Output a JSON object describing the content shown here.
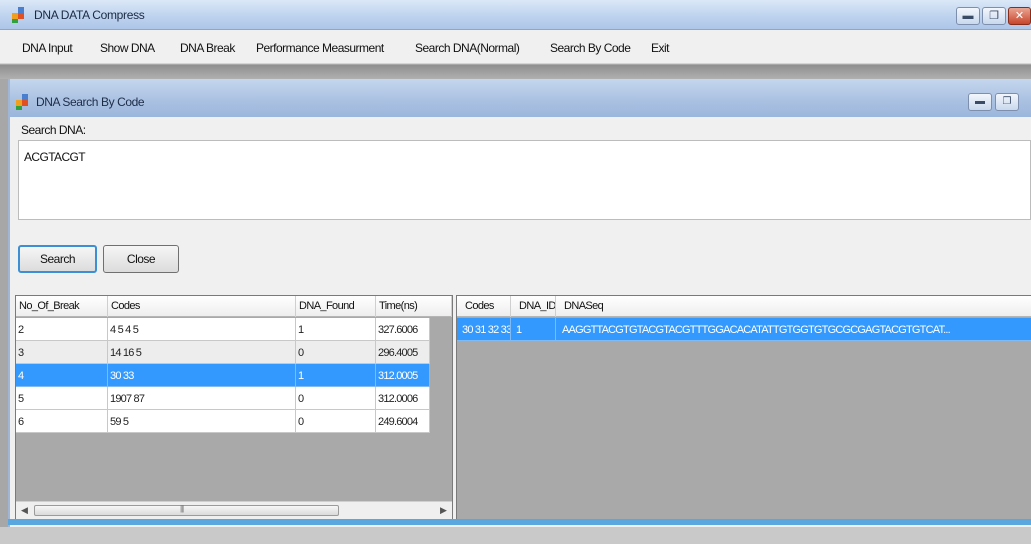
{
  "app": {
    "title": "DNA DATA Compress",
    "window_buttons": {
      "minimize": "▬",
      "restore": "❐",
      "close": "✕"
    }
  },
  "menu": [
    "DNA Input",
    "Show DNA",
    "DNA Break",
    "Performance Measurment",
    "Search DNA(Normal)",
    "Search By Code",
    "Exit"
  ],
  "child": {
    "title": "DNA Search By Code",
    "window_buttons": {
      "minimize": "▬",
      "restore": "❐"
    },
    "search_label": "Search DNA:",
    "search_value": "ACGTACGT",
    "buttons": {
      "search": "Search",
      "close": "Close"
    }
  },
  "left_grid": {
    "columns": [
      "No_Of_Break",
      "Codes",
      "DNA_Found",
      "Time(ns)"
    ],
    "rows": [
      [
        "2",
        "4 5 4 5",
        "1",
        "327.6006"
      ],
      [
        "3",
        "14 16 5",
        "0",
        "296.4005"
      ],
      [
        "4",
        "30 33",
        "1",
        "312.0005"
      ],
      [
        "5",
        "1907 87",
        "0",
        "312.0006"
      ],
      [
        "6",
        "59 5",
        "0",
        "249.6004"
      ]
    ],
    "selected_row": 2,
    "scroll": {
      "left": "◀",
      "grip": "|||",
      "right": "▶"
    }
  },
  "right_grid": {
    "columns": [
      "Codes",
      "DNA_ID",
      "DNASeq"
    ],
    "rows": [
      [
        "30 31 32 33...",
        "1",
        "AAGGTTACGTGTACGTACGTTTGGACACATATTGTGGTGTGCGCGAGTACGTGTCAT..."
      ]
    ],
    "selected_row": 0
  },
  "colors": {
    "selection": "#3399ff",
    "title_gradient": "#bed3ee",
    "status_strip": "#5aa7e0"
  }
}
